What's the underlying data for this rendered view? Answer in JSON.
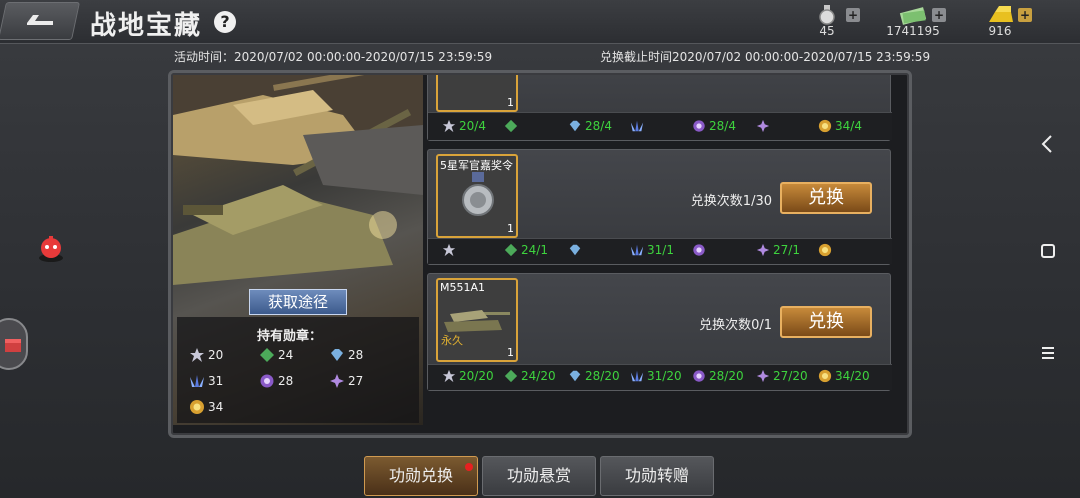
{
  "header": {
    "title": "战地宝藏",
    "help_icon": "?"
  },
  "resources": [
    {
      "name": "medal-resource",
      "value": "45"
    },
    {
      "name": "cash-resource",
      "value": "1741195"
    },
    {
      "name": "gold-resource",
      "value": "916"
    }
  ],
  "event": {
    "activity_time": "活动时间：2020/07/02 00:00:00-2020/07/15 23:59:59",
    "exchange_deadline": "兑换截止时间2020/07/02 00:00:00-2020/07/15 23:59:59"
  },
  "left_panel": {
    "source_button": "获取途径",
    "held_medals_label": "持有勋章：",
    "medals": [
      "20",
      "24",
      "28",
      "31",
      "28",
      "27",
      "34"
    ]
  },
  "cards": [
    {
      "name": "",
      "count": "1",
      "permanent": "",
      "exchange_count": "",
      "button": "",
      "costs": [
        "20/4",
        "",
        "28/4",
        "",
        "28/4",
        "",
        "34/4"
      ]
    },
    {
      "name": "5星军官嘉奖令",
      "count": "1",
      "permanent": "",
      "exchange_count": "兑换次数1/30",
      "button": "兑换",
      "costs": [
        "",
        "24/1",
        "",
        "31/1",
        "",
        "27/1",
        ""
      ]
    },
    {
      "name": "M551A1",
      "count": "1",
      "permanent": "永久",
      "exchange_count": "兑换次数0/1",
      "button": "兑换",
      "costs": [
        "20/20",
        "24/20",
        "28/20",
        "31/20",
        "28/20",
        "27/20",
        "34/20"
      ]
    }
  ],
  "tabs": [
    {
      "label": "功勋兑换",
      "active": true
    },
    {
      "label": "功勋悬赏",
      "active": false
    },
    {
      "label": "功勋转赠",
      "active": false
    }
  ],
  "colors": {
    "accent": "#d9a33a",
    "cost_green": "#3ed33e",
    "tab_active": "#7b5a30"
  }
}
